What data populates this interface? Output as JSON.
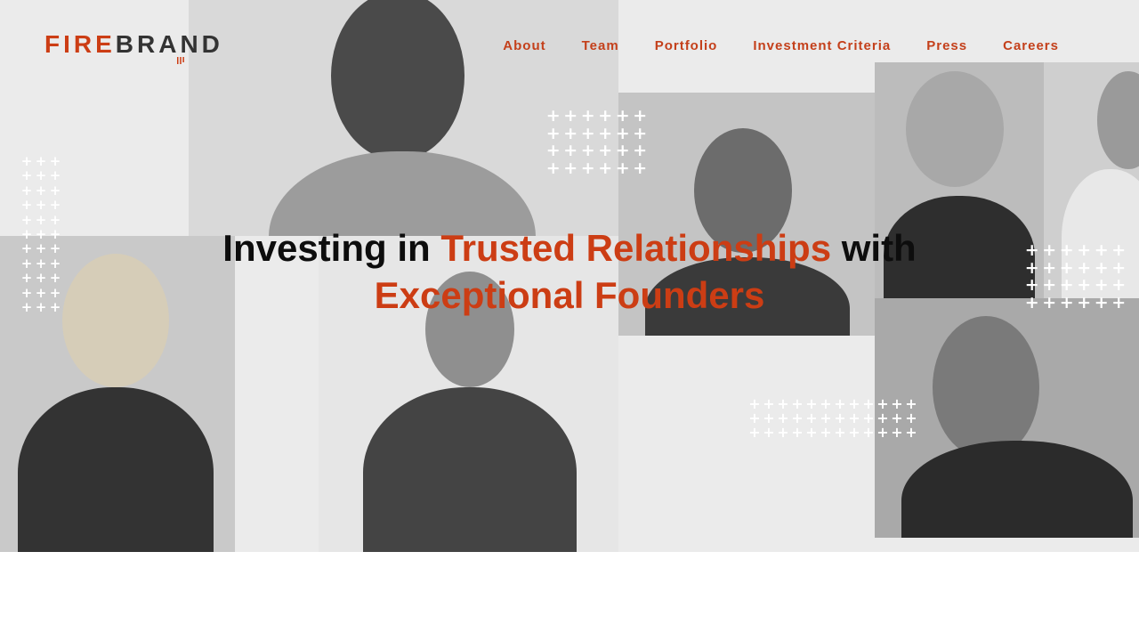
{
  "brand": {
    "logo_text_a": "FIRE",
    "logo_text_b": "BRAND",
    "accent_color": "#cc3d14",
    "dark_color": "#333333"
  },
  "nav": {
    "items": [
      {
        "label": "About"
      },
      {
        "label": "Team"
      },
      {
        "label": "Portfolio"
      },
      {
        "label": "Investment Criteria"
      },
      {
        "label": "Press"
      },
      {
        "label": "Careers"
      }
    ]
  },
  "hero": {
    "line1_a": "Investing in",
    "line1_b": "Trusted Relationships",
    "line1_c": "with",
    "line2": "Exceptional Founders"
  },
  "icons": {
    "plus": "+"
  }
}
